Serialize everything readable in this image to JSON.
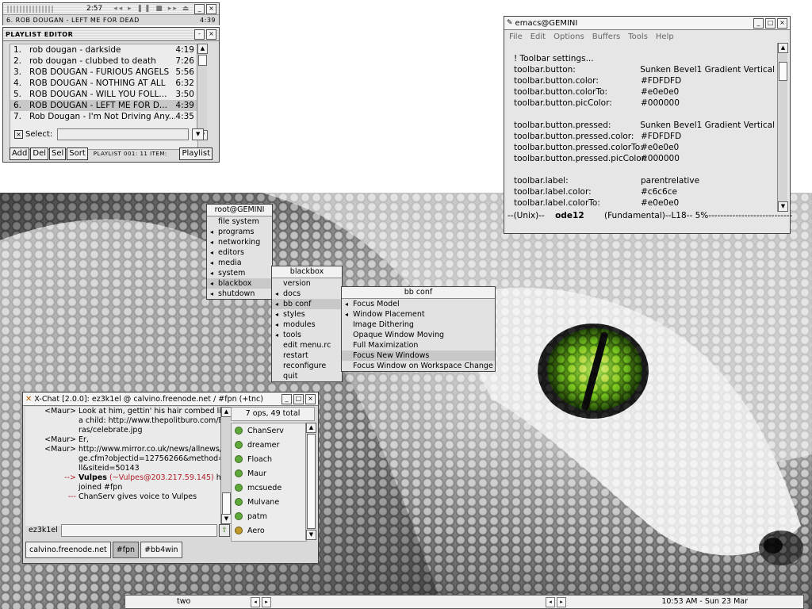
{
  "xmms": {
    "time": "2:57",
    "track": "6. ROB DOUGAN - LEFT ME FOR DEAD",
    "track_time": "4:39",
    "playlist_title": "PLAYLIST EDITOR",
    "playlist": [
      {
        "num": "1.",
        "name": "rob dougan - darkside",
        "time": "4:19"
      },
      {
        "num": "2.",
        "name": "rob dougan - clubbed to death",
        "time": "7:26"
      },
      {
        "num": "3.",
        "name": "ROB DOUGAN - FURIOUS ANGELS",
        "time": "5:56"
      },
      {
        "num": "4.",
        "name": "ROB DOUGAN - NOTHING AT ALL",
        "time": "6:32"
      },
      {
        "num": "5.",
        "name": "ROB DOUGAN - WILL YOU FOLL...",
        "time": "3:50"
      },
      {
        "num": "6.",
        "name": "ROB DOUGAN - LEFT ME FOR D...",
        "time": "4:39"
      },
      {
        "num": "7.",
        "name": "Rob Dougan - I'm Not Driving Any...",
        "time": "4:35"
      }
    ],
    "select_label": "Select:",
    "buttons": {
      "add": "Add",
      "del": "Del",
      "sel": "Sel",
      "sort": "Sort",
      "playlist": "Playlist"
    },
    "info": "PLAYLIST 001: 11 ITEM:"
  },
  "emacs": {
    "title": "emacs@GEMINI",
    "menu": [
      "File",
      "Edit",
      "Options",
      "Buffers",
      "Tools",
      "Help"
    ],
    "lines": [
      {
        "k": "! Toolbar settings...",
        "v": ""
      },
      {
        "k": "toolbar.button:",
        "v": "Sunken Bevel1 Gradient Vertical"
      },
      {
        "k": "toolbar.button.color:",
        "v": "#FDFDFD"
      },
      {
        "k": "toolbar.button.colorTo:",
        "v": "#e0e0e0"
      },
      {
        "k": "toolbar.button.picColor:",
        "v": "#000000"
      },
      {
        "k": "",
        "v": ""
      },
      {
        "k": "toolbar.button.pressed:",
        "v": "Sunken Bevel1 Gradient Vertical"
      },
      {
        "k": "toolbar.button.pressed.color:",
        "v": "#FDFDFD"
      },
      {
        "k": "toolbar.button.pressed.colorTo:",
        "v": "#e0e0e0"
      },
      {
        "k": "toolbar.button.pressed.picColor:",
        "v": "#000000"
      },
      {
        "k": "",
        "v": ""
      },
      {
        "k": "toolbar.label:",
        "v": "parentrelative"
      },
      {
        "k": "toolbar.label.color:",
        "v": "#c6c6ce"
      },
      {
        "k": "toolbar.label.colorTo:",
        "v": "#e0e0e0"
      }
    ],
    "modeline_left": "--(Unix)--",
    "modeline_buffer": "ode12",
    "modeline_right": "(Fundamental)--L18-- 5%----------------------------"
  },
  "menus": {
    "root": {
      "title": "root@GEMINI",
      "items": [
        {
          "label": "file system",
          "sub": false
        },
        {
          "label": "programs",
          "sub": true
        },
        {
          "label": "networking",
          "sub": true
        },
        {
          "label": "editors",
          "sub": true
        },
        {
          "label": "media",
          "sub": true
        },
        {
          "label": "system",
          "sub": true
        },
        {
          "label": "blackbox",
          "sub": true
        },
        {
          "label": "shutdown",
          "sub": true
        }
      ]
    },
    "blackbox": {
      "title": "blackbox",
      "items": [
        {
          "label": "version",
          "sub": false
        },
        {
          "label": "docs",
          "sub": true
        },
        {
          "label": "bb conf",
          "sub": true
        },
        {
          "label": "styles",
          "sub": true
        },
        {
          "label": "modules",
          "sub": true
        },
        {
          "label": "tools",
          "sub": true
        },
        {
          "label": "edit menu.rc",
          "sub": false
        },
        {
          "label": "restart",
          "sub": false
        },
        {
          "label": "reconfigure",
          "sub": false
        },
        {
          "label": "quit",
          "sub": false
        }
      ]
    },
    "bbconf": {
      "title": "bb conf",
      "items": [
        {
          "label": "Focus Model",
          "sub": true
        },
        {
          "label": "Window Placement",
          "sub": true
        },
        {
          "label": "Image Dithering",
          "sub": false
        },
        {
          "label": "Opaque Window Moving",
          "sub": false
        },
        {
          "label": "Full Maximization",
          "sub": false
        },
        {
          "label": "Focus New Windows",
          "sub": false
        },
        {
          "label": "Focus Window on Workspace Change",
          "sub": false
        }
      ]
    }
  },
  "xchat": {
    "title": "X-Chat [2.0.0]: ez3k1el @ calvino.freenode.net / #fpn (+tnc)",
    "lines": [
      {
        "nick": "<Maur>",
        "msg": "Look at him, gettin' his hair combed like a child: http://www.thepolitburo.com/Extras/celebrate.jpg"
      },
      {
        "nick": "<Maur>",
        "msg": "Er,"
      },
      {
        "nick": "<Maur>",
        "msg": "http://www.mirror.co.uk/news/allnews/page.cfm?objectid=12756266&method=full&siteid=50143"
      }
    ],
    "join_arrow": "-->",
    "join_nick": "Vulpes",
    "join_host": "(~Vulpes@203.217.59.145)",
    "join_text": "has joined #fpn",
    "voice_marker": "---",
    "voice_text": "ChanServ gives voice to Vulpes",
    "user_count": "7 ops, 49 total",
    "users": [
      {
        "name": "ChanServ",
        "voice": false
      },
      {
        "name": "dreamer",
        "voice": false
      },
      {
        "name": "Floach",
        "voice": false
      },
      {
        "name": "Maur",
        "voice": false
      },
      {
        "name": "mcsuede",
        "voice": false
      },
      {
        "name": "Mulvane",
        "voice": false
      },
      {
        "name": "patm",
        "voice": false
      },
      {
        "name": "Aero",
        "voice": true
      }
    ],
    "input_nick": "ez3k1el",
    "tabs": [
      {
        "label": "calvino.freenode.net",
        "active": false
      },
      {
        "label": "#fpn",
        "active": true
      },
      {
        "label": "#bb4win",
        "active": false
      }
    ]
  },
  "toolbar": {
    "workspace": "two",
    "clock": "10:53 AM - Sun 23 Mar"
  },
  "colors": {
    "join": "#b0202a"
  }
}
